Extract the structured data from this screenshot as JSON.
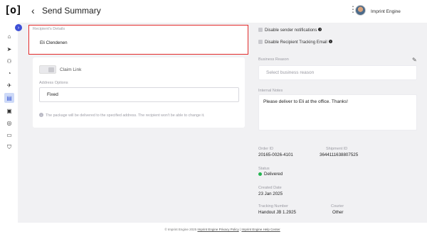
{
  "app": {
    "logo_text": "[o]",
    "page_title": "Send Summary",
    "user_name": "Imprint Engine"
  },
  "icons": {
    "back": "chevron-left-icon",
    "more": "kebab-menu-icon",
    "sidebar": [
      "home-icon",
      "send-icon",
      "network-icon",
      "analytics-icon",
      "rocket-icon",
      "clipboard-icon",
      "gift-box-icon",
      "target-icon",
      "cards-icon",
      "shield-icon"
    ]
  },
  "recipient": {
    "label": "Recipient's Details",
    "name": "Eli Clendenen"
  },
  "delivery": {
    "claim_link_label": "Claim Link",
    "address_options_label": "Address Options",
    "address_option_value": "Fixed",
    "info_text": "The package will be delivered to the specified address. The recipient won't be able to change it."
  },
  "settings": {
    "disable_sender_notifications": "Disable sender notifications",
    "disable_tracking_email": "Disable Recipient Tracking Email",
    "business_reason_label": "Business Reason",
    "business_reason_placeholder": "Select business reason",
    "internal_notes_label": "Internal Notes",
    "internal_notes_value": "Please deliver to Eli at the office. Thanks!"
  },
  "order": {
    "order_id_label": "Order ID",
    "order_id": "20165-0026-4101",
    "shipment_id_label": "Shipment ID",
    "shipment_id": "3644111638807525",
    "status_label": "Status",
    "status": "Delivered",
    "created_label": "Created Date",
    "created": "23 Jan 2025",
    "tracking_label": "Tracking Number",
    "tracking": "Handout JB 1.2925",
    "courier_label": "Courier",
    "courier": "Other"
  },
  "footer": {
    "copyright": "© Imprint Engine 2025",
    "privacy_link": "Imprint Engine Privacy Policy",
    "separator": "|",
    "help_link": "Imprint Engine Help Center"
  },
  "colors": {
    "accent": "#3d4fd6",
    "highlight_border": "#e32b2b",
    "status_green": "#26b552"
  }
}
